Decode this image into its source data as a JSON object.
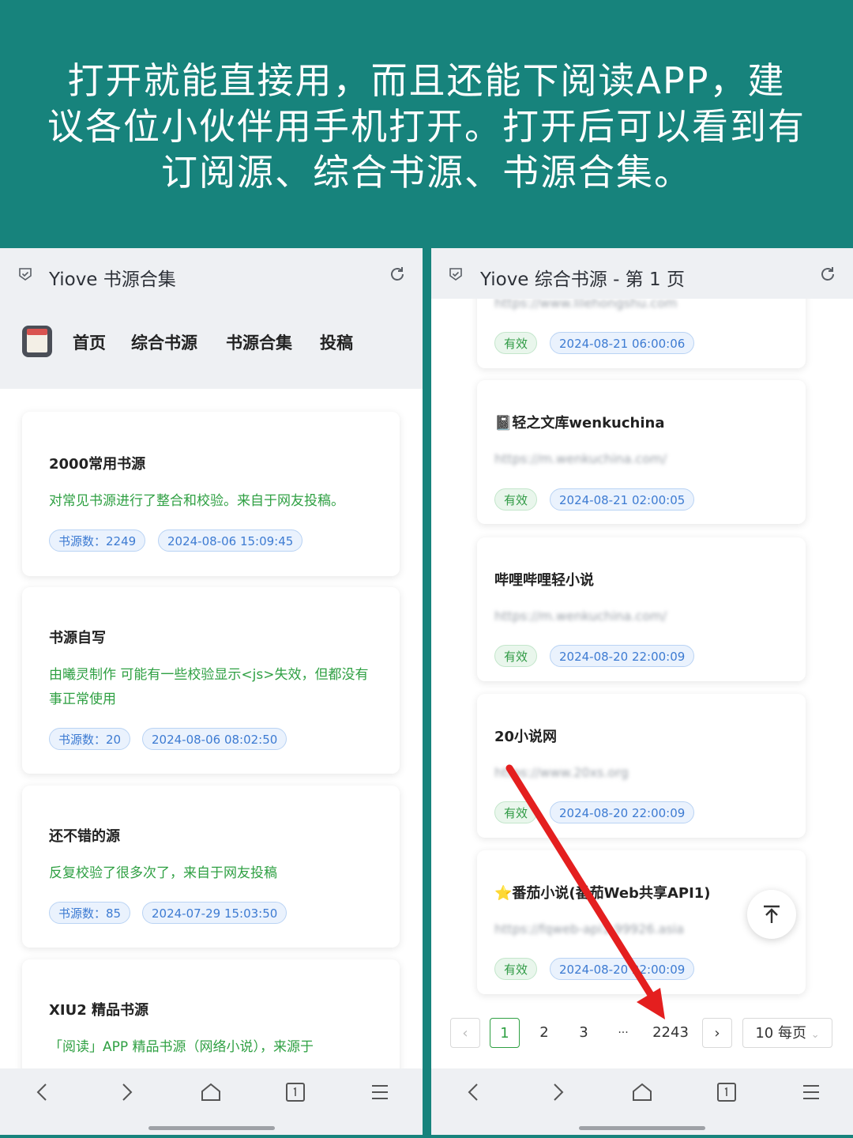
{
  "banner": {
    "lines": [
      "打开就能直接用，而且还能下阅读APP，建",
      "议各位小伙伴用手机打开。打开后可以看到有",
      "订阅源、综合书源、书源合集。"
    ]
  },
  "left": {
    "title": "Yiove 书源合集",
    "nav": [
      "首页",
      "综合书源",
      "书源合集",
      "投稿"
    ],
    "cards": [
      {
        "title": "2000常用书源",
        "desc": "对常见书源进行了整合和校验。来自于网友投稿。",
        "count": "书源数：2249",
        "date": "2024-08-06 15:09:45"
      },
      {
        "title": "书源自写",
        "desc": "由曦灵制作 可能有一些校验显示<js>失效，但都没有事正常使用",
        "count": "书源数：20",
        "date": "2024-08-06 08:02:50"
      },
      {
        "title": "还不错的源",
        "desc": "反复校验了很多次了，来自于网友投稿",
        "count": "书源数：85",
        "date": "2024-07-29 15:03:50"
      },
      {
        "title": "XIU2 精品书源",
        "desc": "「阅读」APP 精品书源（网络小说），来源于"
      }
    ]
  },
  "right": {
    "title": "Yiove 综合书源 - 第 1 页",
    "cards": [
      {
        "title": "",
        "url": "https://www.lilehongshu.com",
        "status": "有效",
        "date": "2024-08-21 06:00:06"
      },
      {
        "title": "📓轻之文库wenkuchina",
        "url": "https://m.wenkuchina.com/",
        "status": "有效",
        "date": "2024-08-21 02:00:05"
      },
      {
        "title": "哔哩哔哩轻小说",
        "url": "https://m.wenkuchina.com/",
        "status": "有效",
        "date": "2024-08-20 22:00:09"
      },
      {
        "title": "20小说网",
        "url": "https://www.20xs.org",
        "status": "有效",
        "date": "2024-08-20 22:00:09"
      },
      {
        "title": "⭐番茄小说(番茄Web共享API1)",
        "url": "https://fqweb-api1.99926.asia",
        "status": "有效",
        "date": "2024-08-20 22:00:09"
      }
    ],
    "pager": {
      "pages": [
        "1",
        "2",
        "3",
        "···",
        "2243"
      ],
      "page_size": "10 每页"
    }
  }
}
